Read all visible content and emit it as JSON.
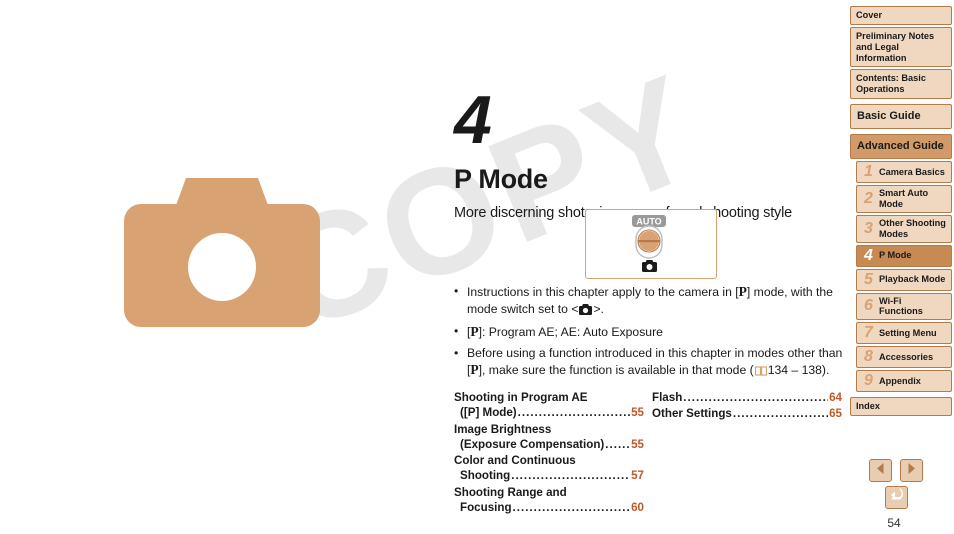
{
  "watermark": {
    "text": "COPY"
  },
  "chapter": {
    "number": "4",
    "title": "P Mode",
    "subtitle": "More discerning shots, in your preferred shooting style"
  },
  "figure": {
    "auto_label": "AUTO",
    "dial_icon": "mode-dial-icon",
    "camera_icon": "camera-icon"
  },
  "bullets": [
    {
      "dot": "•",
      "pre": "Instructions in this chapter apply to the camera in [",
      "mode": "P",
      "mid": "] mode, with the mode switch set to <",
      "post": ">."
    },
    {
      "dot": "•",
      "pre": "[",
      "mode": "P",
      "mid": "]: Program AE; AE: Auto Exposure",
      "post": ""
    },
    {
      "dot": "•",
      "pre": "Before using a function introduced in this chapter in modes other than [",
      "mode": "P",
      "mid": "], make sure the function is available in that mode (",
      "post": "134 – 138)."
    }
  ],
  "toc": {
    "left": [
      {
        "line1": "Shooting in Program AE",
        "line2": "([P] Mode)",
        "page": "55"
      },
      {
        "line1": "Image Brightness",
        "line2": "(Exposure Compensation)",
        "page": "55"
      },
      {
        "line1": "Color and Continuous",
        "line2": "Shooting",
        "page": "57"
      },
      {
        "line1": "Shooting Range and",
        "line2": "Focusing",
        "page": "60"
      }
    ],
    "right": [
      {
        "line1": "",
        "line2": "Flash",
        "page": "64"
      },
      {
        "line1": "",
        "line2": "Other Settings ",
        "page": "65"
      }
    ],
    "dots": "........................................."
  },
  "sidebar": {
    "top_items": [
      {
        "label": "Cover"
      },
      {
        "label": "Preliminary Notes and Legal Information"
      },
      {
        "label": "Contents: Basic Operations"
      }
    ],
    "guides": [
      {
        "label": "Basic Guide"
      },
      {
        "label": "Advanced Guide"
      }
    ],
    "chapters": [
      {
        "num": "1",
        "label": "Camera Basics"
      },
      {
        "num": "2",
        "label": "Smart Auto Mode"
      },
      {
        "num": "3",
        "label": "Other Shooting Modes"
      },
      {
        "num": "4",
        "label": "P Mode"
      },
      {
        "num": "5",
        "label": "Playback Mode"
      },
      {
        "num": "6",
        "label": "Wi-Fi Functions"
      },
      {
        "num": "7",
        "label": "Setting Menu"
      },
      {
        "num": "8",
        "label": "Accessories"
      },
      {
        "num": "9",
        "label": "Appendix"
      }
    ],
    "index": {
      "label": "Index"
    }
  },
  "controls": {
    "prev": "previous-page-button",
    "next": "next-page-button",
    "back": "return-button",
    "page_number": "54"
  },
  "colors": {
    "accent_orange": "#c0582a",
    "tan": "#d9a273",
    "sidebar_bg": "#f0d7c0",
    "sidebar_active": "#c68a52",
    "advanced_bg": "#d29a66",
    "border": "#b5794a"
  }
}
